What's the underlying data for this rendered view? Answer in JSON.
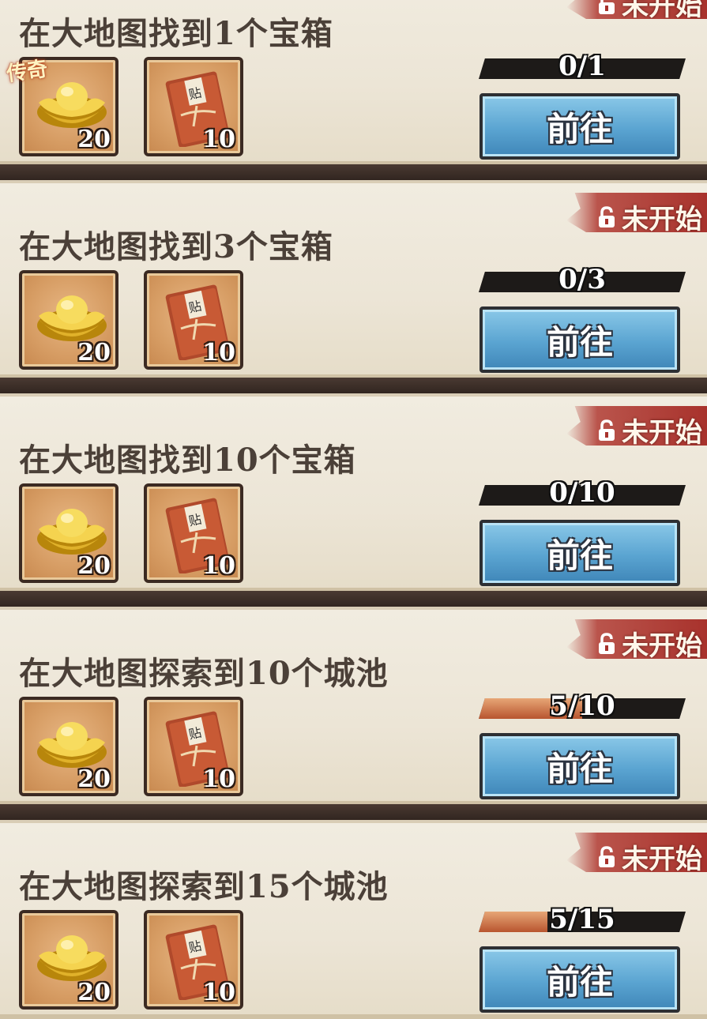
{
  "tasks": [
    {
      "title": "在大地图找到1个宝箱",
      "status": "未开始",
      "progress_text": "0/1",
      "progress": 0.0,
      "button": "前往",
      "badge": "传奇",
      "rewards": [
        {
          "icon": "gold-ingot-icon",
          "qty": "20"
        },
        {
          "icon": "red-book-icon",
          "qty": "10"
        }
      ]
    },
    {
      "title": "在大地图找到3个宝箱",
      "status": "未开始",
      "progress_text": "0/3",
      "progress": 0.0,
      "button": "前往",
      "badge": "",
      "rewards": [
        {
          "icon": "gold-ingot-icon",
          "qty": "20"
        },
        {
          "icon": "red-book-icon",
          "qty": "10"
        }
      ]
    },
    {
      "title": "在大地图找到10个宝箱",
      "status": "未开始",
      "progress_text": "0/10",
      "progress": 0.0,
      "button": "前往",
      "badge": "",
      "rewards": [
        {
          "icon": "gold-ingot-icon",
          "qty": "20"
        },
        {
          "icon": "red-book-icon",
          "qty": "10"
        }
      ]
    },
    {
      "title": "在大地图探索到10个城池",
      "status": "未开始",
      "progress_text": "5/10",
      "progress": 0.5,
      "button": "前往",
      "badge": "",
      "rewards": [
        {
          "icon": "gold-ingot-icon",
          "qty": "20"
        },
        {
          "icon": "red-book-icon",
          "qty": "10"
        }
      ]
    },
    {
      "title": "在大地图探索到15个城池",
      "status": "未开始",
      "progress_text": "5/15",
      "progress": 0.333,
      "button": "前往",
      "badge": "",
      "rewards": [
        {
          "icon": "gold-ingot-icon",
          "qty": "20"
        },
        {
          "icon": "red-book-icon",
          "qty": "10"
        }
      ]
    }
  ],
  "colors": {
    "button": "#5aa4d1",
    "status": "#a8322c",
    "progress_fill": "#c7643a"
  }
}
